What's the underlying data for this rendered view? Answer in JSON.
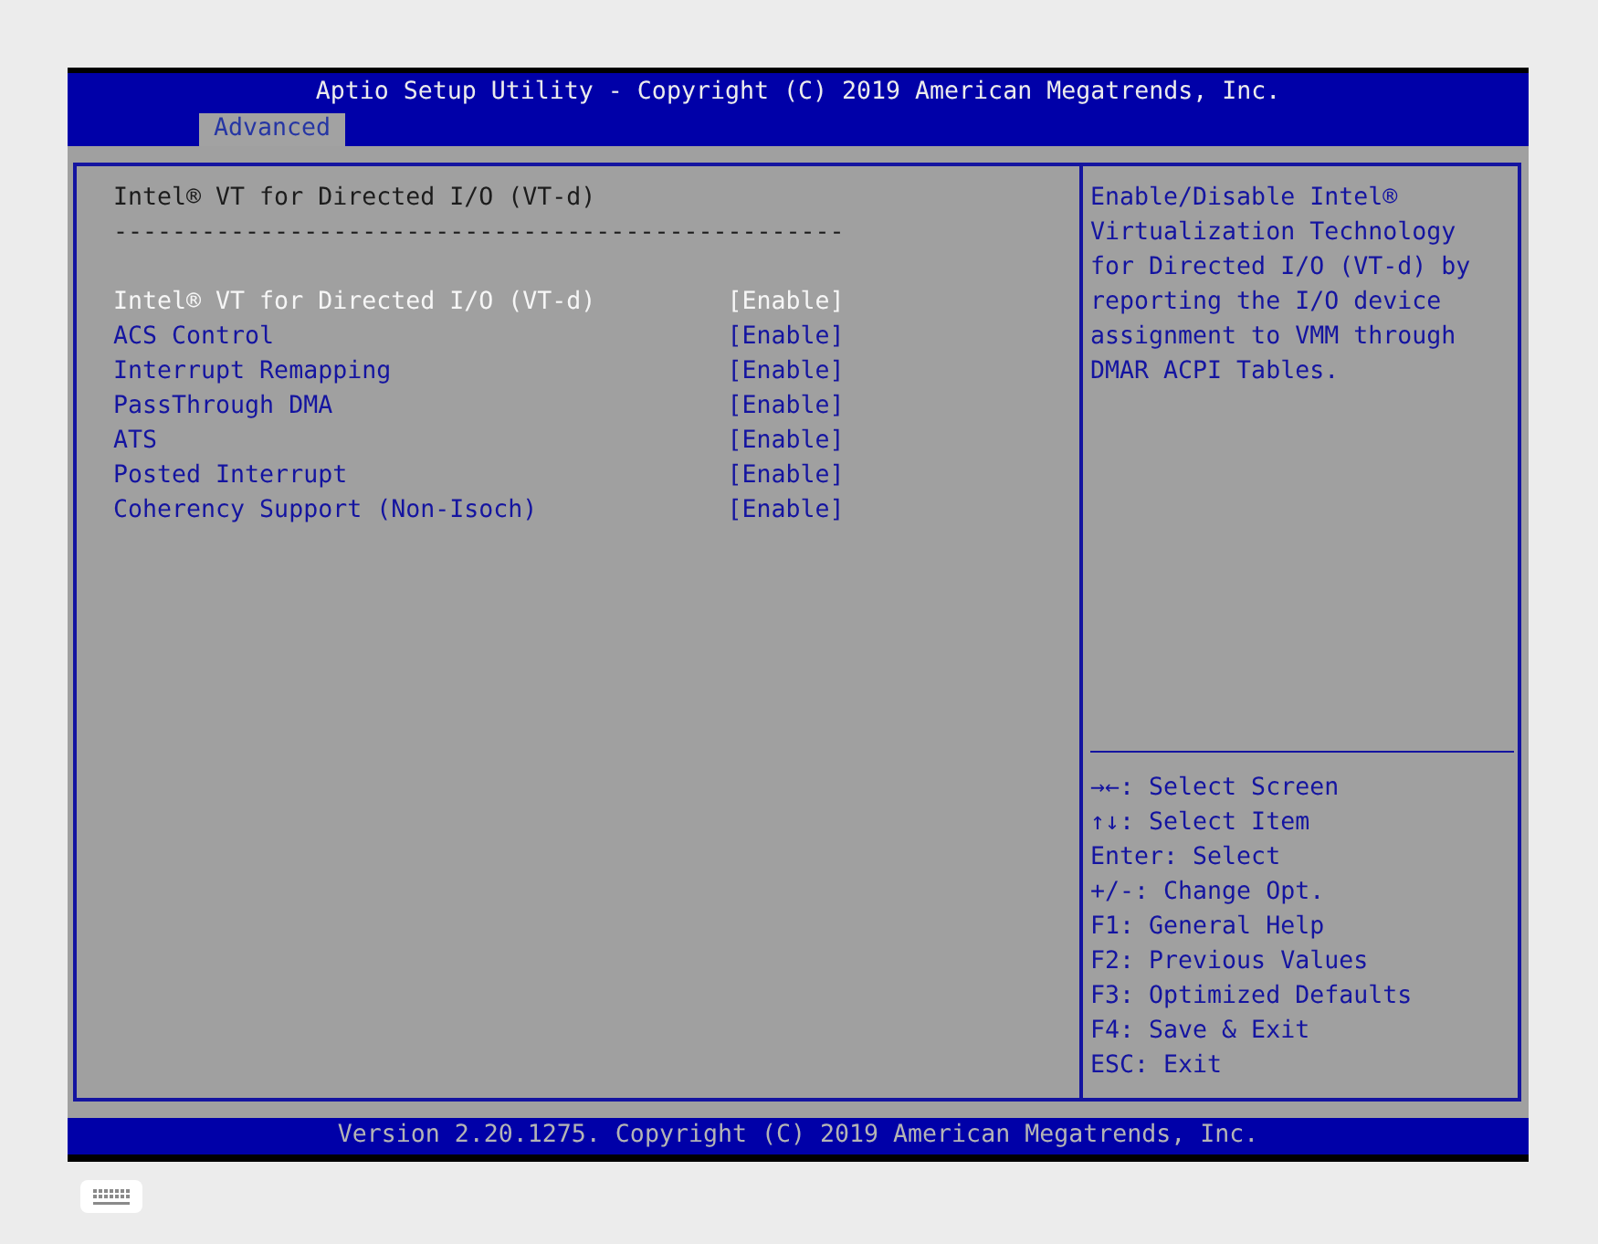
{
  "header": {
    "title": "Aptio Setup Utility - Copyright (C) 2019 American Megatrends, Inc."
  },
  "tabs": [
    {
      "label": "Advanced",
      "selected": true
    }
  ],
  "settings": {
    "heading": "Intel® VT for Directed I/O (VT-d)",
    "separator": "--------------------------------------------------",
    "items": [
      {
        "label": "Intel® VT for Directed I/O (VT-d)",
        "value": "[Enable]",
        "selected": true
      },
      {
        "label": "ACS Control",
        "value": "[Enable]",
        "selected": false
      },
      {
        "label": "Interrupt Remapping",
        "value": "[Enable]",
        "selected": false
      },
      {
        "label": "PassThrough DMA",
        "value": "[Enable]",
        "selected": false
      },
      {
        "label": "ATS",
        "value": "[Enable]",
        "selected": false
      },
      {
        "label": "Posted Interrupt",
        "value": "[Enable]",
        "selected": false
      },
      {
        "label": "Coherency Support (Non-Isoch)",
        "value": "[Enable]",
        "selected": false
      }
    ]
  },
  "help": {
    "description": "Enable/Disable Intel® Virtualization Technology for Directed I/O (VT-d) by reporting the I/O device assignment to VMM through DMAR ACPI Tables.",
    "keys": [
      "→←: Select Screen",
      "↑↓: Select Item",
      "Enter: Select",
      "+/-: Change Opt.",
      "F1: General Help",
      "F2: Previous Values",
      "F3: Optimized Defaults",
      "F4: Save & Exit",
      "ESC: Exit"
    ]
  },
  "footer": {
    "text": "Version 2.20.1275. Copyright (C) 2019 American Megatrends, Inc."
  }
}
